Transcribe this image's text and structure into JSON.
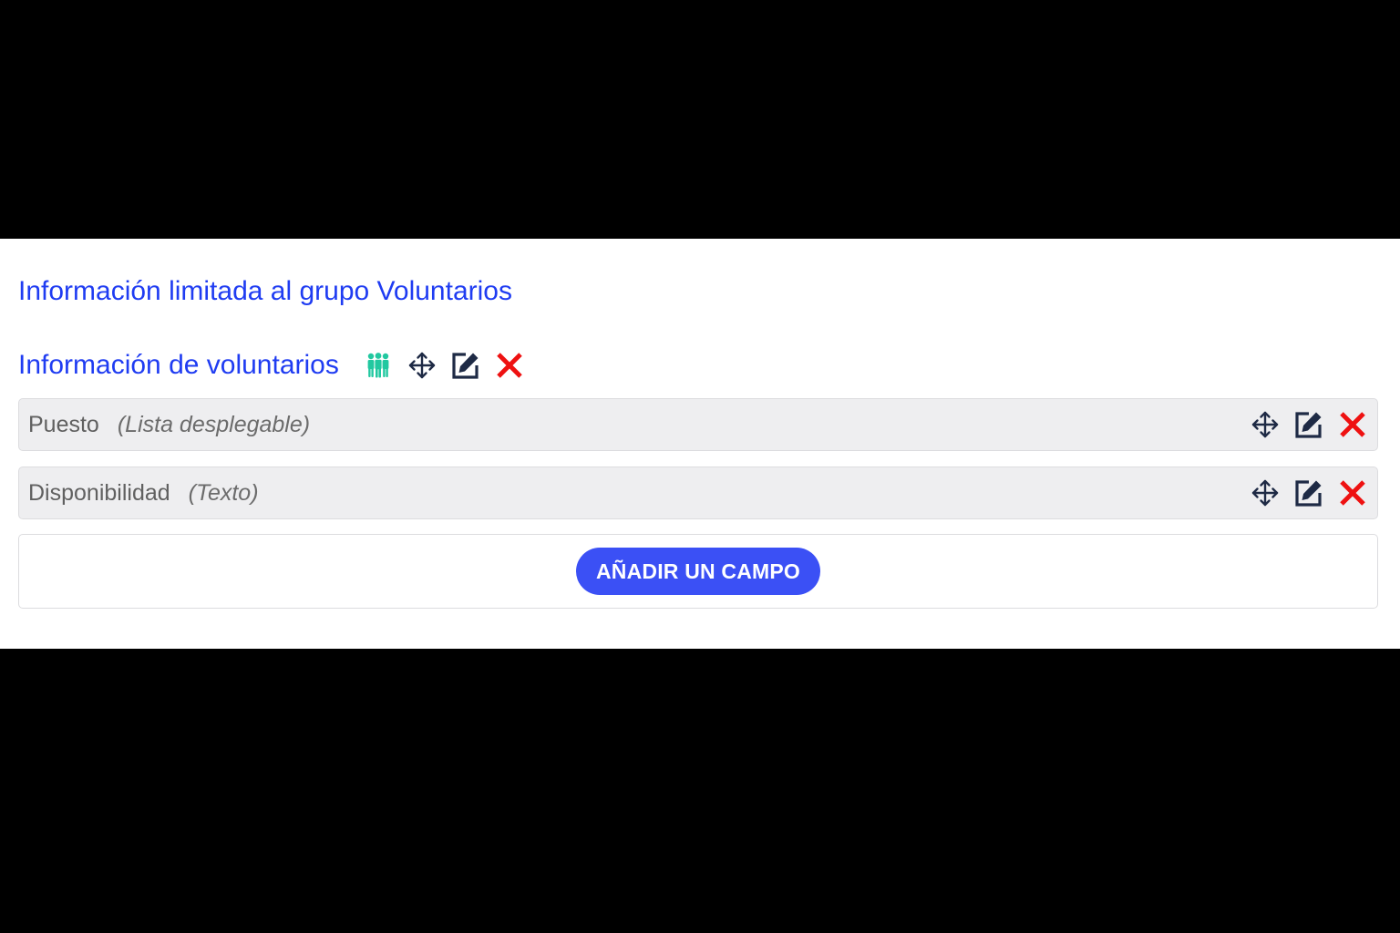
{
  "restriction": {
    "title": "Información limitada al grupo Voluntarios"
  },
  "section": {
    "title": "Información de voluntarios",
    "icons": [
      "group-icon",
      "move-icon",
      "edit-icon",
      "delete-icon"
    ]
  },
  "fields": [
    {
      "name": "Puesto",
      "type": "(Lista desplegable)"
    },
    {
      "name": "Disponibilidad",
      "type": "(Texto)"
    }
  ],
  "add_field": {
    "label": "AÑADIR UN CAMPO"
  },
  "colors": {
    "title_blue": "#1f3cf2",
    "button_blue": "#3b50f5",
    "group_teal": "#21c8a0",
    "icon_navy": "#1e2a45",
    "delete_red": "#ee1111",
    "field_bg": "#eeeef0",
    "field_text": "#606060",
    "field_type_text": "#6c6c6c"
  }
}
